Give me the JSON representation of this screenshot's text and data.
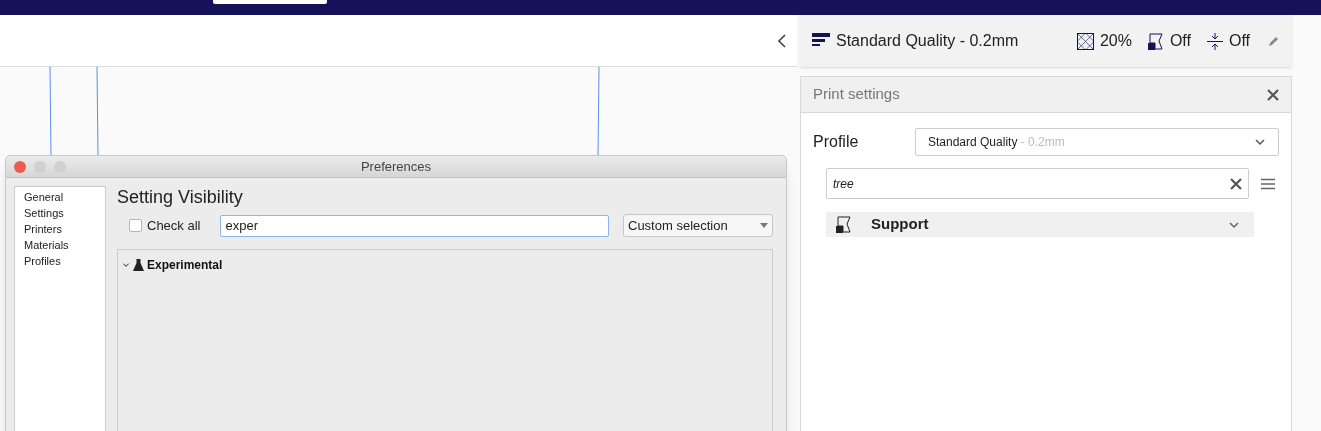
{
  "header": {
    "quality": "Standard Quality - 0.2mm",
    "infill": "20%",
    "support": "Off",
    "adhesion": "Off"
  },
  "print_settings": {
    "title": "Print settings",
    "profile_label": "Profile",
    "profile_name": "Standard Quality",
    "profile_suffix": " - 0.2mm",
    "search_value": "tree",
    "categories": [
      {
        "label": "Support"
      }
    ]
  },
  "preferences": {
    "title": "Preferences",
    "sidebar": [
      {
        "label": "General"
      },
      {
        "label": "Settings"
      },
      {
        "label": "Printers"
      },
      {
        "label": "Materials"
      },
      {
        "label": "Profiles"
      }
    ],
    "heading": "Setting Visibility",
    "check_all": {
      "label": "Check all",
      "checked": false
    },
    "filter_value": "exper",
    "preset": "Custom selection",
    "tree": [
      {
        "label": "Experimental",
        "expanded": true
      }
    ]
  }
}
